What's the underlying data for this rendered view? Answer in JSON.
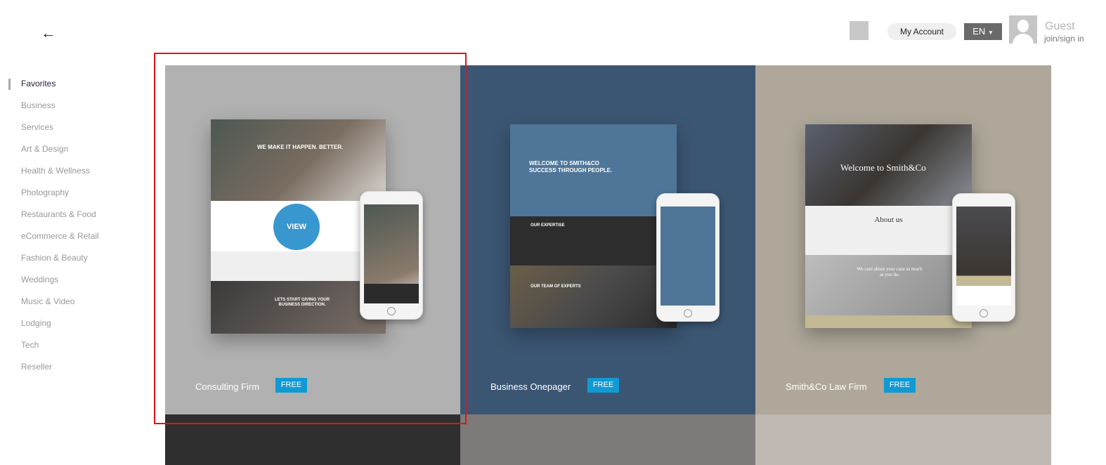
{
  "header": {
    "my_account": "My Account",
    "language": "EN",
    "user_name": "Guest",
    "join_link": "join/sign in"
  },
  "sidebar": {
    "items": [
      {
        "label": "Favorites",
        "active": true
      },
      {
        "label": "Business"
      },
      {
        "label": "Services"
      },
      {
        "label": "Art & Design"
      },
      {
        "label": "Health & Wellness"
      },
      {
        "label": "Photography"
      },
      {
        "label": "Restaurants & Food"
      },
      {
        "label": "eCommerce & Retail"
      },
      {
        "label": "Fashion & Beauty"
      },
      {
        "label": "Weddings"
      },
      {
        "label": "Music & Video"
      },
      {
        "label": "Lodging"
      },
      {
        "label": "Tech"
      },
      {
        "label": "Reseller"
      }
    ]
  },
  "templates": [
    {
      "name": "Consulting Firm",
      "badge": "FREE",
      "bg": "#b1b1b1",
      "hover_label": "VIEW",
      "preview_headline": "WE MAKE IT HAPPEN. BETTER.",
      "preview_cta": "LETS START GIVING YOUR BUSINESS DIRECTION."
    },
    {
      "name": "Business Onepager",
      "badge": "FREE",
      "bg": "#3b5673",
      "preview_headline": "WELCOME TO SMITH&CO SUCCESS THROUGH PEOPLE.",
      "preview_section": "OUR EXPERTISE",
      "preview_team": "OUR TEAM OF EXPERTS"
    },
    {
      "name": "Smith&Co Law Firm",
      "badge": "FREE",
      "bg": "#aea79a",
      "preview_headline": "Welcome to Smith&Co",
      "preview_about": "About us",
      "preview_tagline": "We care about your case as much as you do."
    }
  ],
  "row2_colors": [
    "#2f2f2f",
    "#7e7a79",
    "#c0b8b2"
  ],
  "accent": "#0f9ad3"
}
